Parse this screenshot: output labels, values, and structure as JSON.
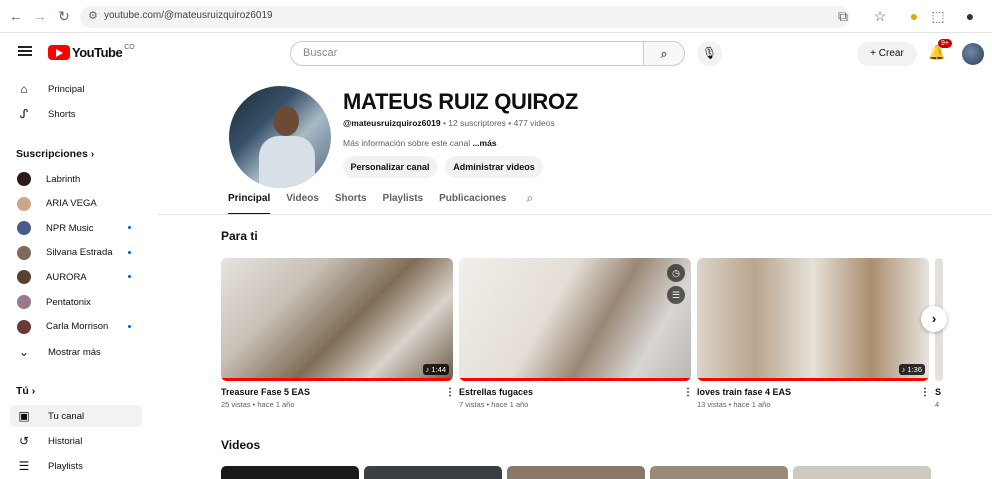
{
  "browser": {
    "url": "youtube.com/@mateusruizquiroz6019"
  },
  "header": {
    "logo_text": "YouTube",
    "country_code": "CO",
    "search_placeholder": "Buscar",
    "create_label": "Crear",
    "notif_count": "9+"
  },
  "sidebar": {
    "principal": "Principal",
    "shorts": "Shorts",
    "subs_title": "Suscripciones",
    "subs": [
      {
        "label": "Labrinth",
        "new": false,
        "color": "#2b1b1b"
      },
      {
        "label": "ARIA VEGA",
        "new": false,
        "color": "#c9a98a"
      },
      {
        "label": "NPR Music",
        "new": true,
        "color": "#4a5a8a"
      },
      {
        "label": "Silvana Estrada",
        "new": true,
        "color": "#7d6a5a"
      },
      {
        "label": "AURORA",
        "new": true,
        "color": "#5a4030"
      },
      {
        "label": "Pentatonix",
        "new": false,
        "color": "#9a7a8a"
      },
      {
        "label": "Carla Morrison",
        "new": true,
        "color": "#6a3a3a"
      }
    ],
    "show_more": "Mostrar más",
    "you_title": "Tú",
    "you_items": [
      "Tu canal",
      "Historial",
      "Playlists"
    ]
  },
  "channel": {
    "name": "MATEUS RUIZ QUIROZ",
    "handle": "@mateusruizquiroz6019",
    "stats": " • 12 suscriptores • 477 videos",
    "more_info": "Más información sobre este canal ",
    "more_link": "...más",
    "btn_customize": "Personalizar canal",
    "btn_manage": "Administrar videos"
  },
  "tabs": [
    "Principal",
    "Videos",
    "Shorts",
    "Playlists",
    "Publicaciones"
  ],
  "section_for_you": "Para ti",
  "section_videos": "Videos",
  "videos": [
    {
      "title": "Treasure Fase 5 EAS",
      "meta": "25 vistas • hace 1 año",
      "duration": "♪ 1:44"
    },
    {
      "title": "Estrellas fugaces",
      "meta": "7 vistas • hace 1 año",
      "duration": ""
    },
    {
      "title": "loves train fase 4 EAS",
      "meta": "13 vistas • hace 1 año",
      "duration": "♪ 1:36"
    }
  ],
  "partial_video": {
    "title": "S",
    "meta": "4"
  },
  "colors": {
    "red": "#ff0000",
    "link": "#065fd4"
  }
}
